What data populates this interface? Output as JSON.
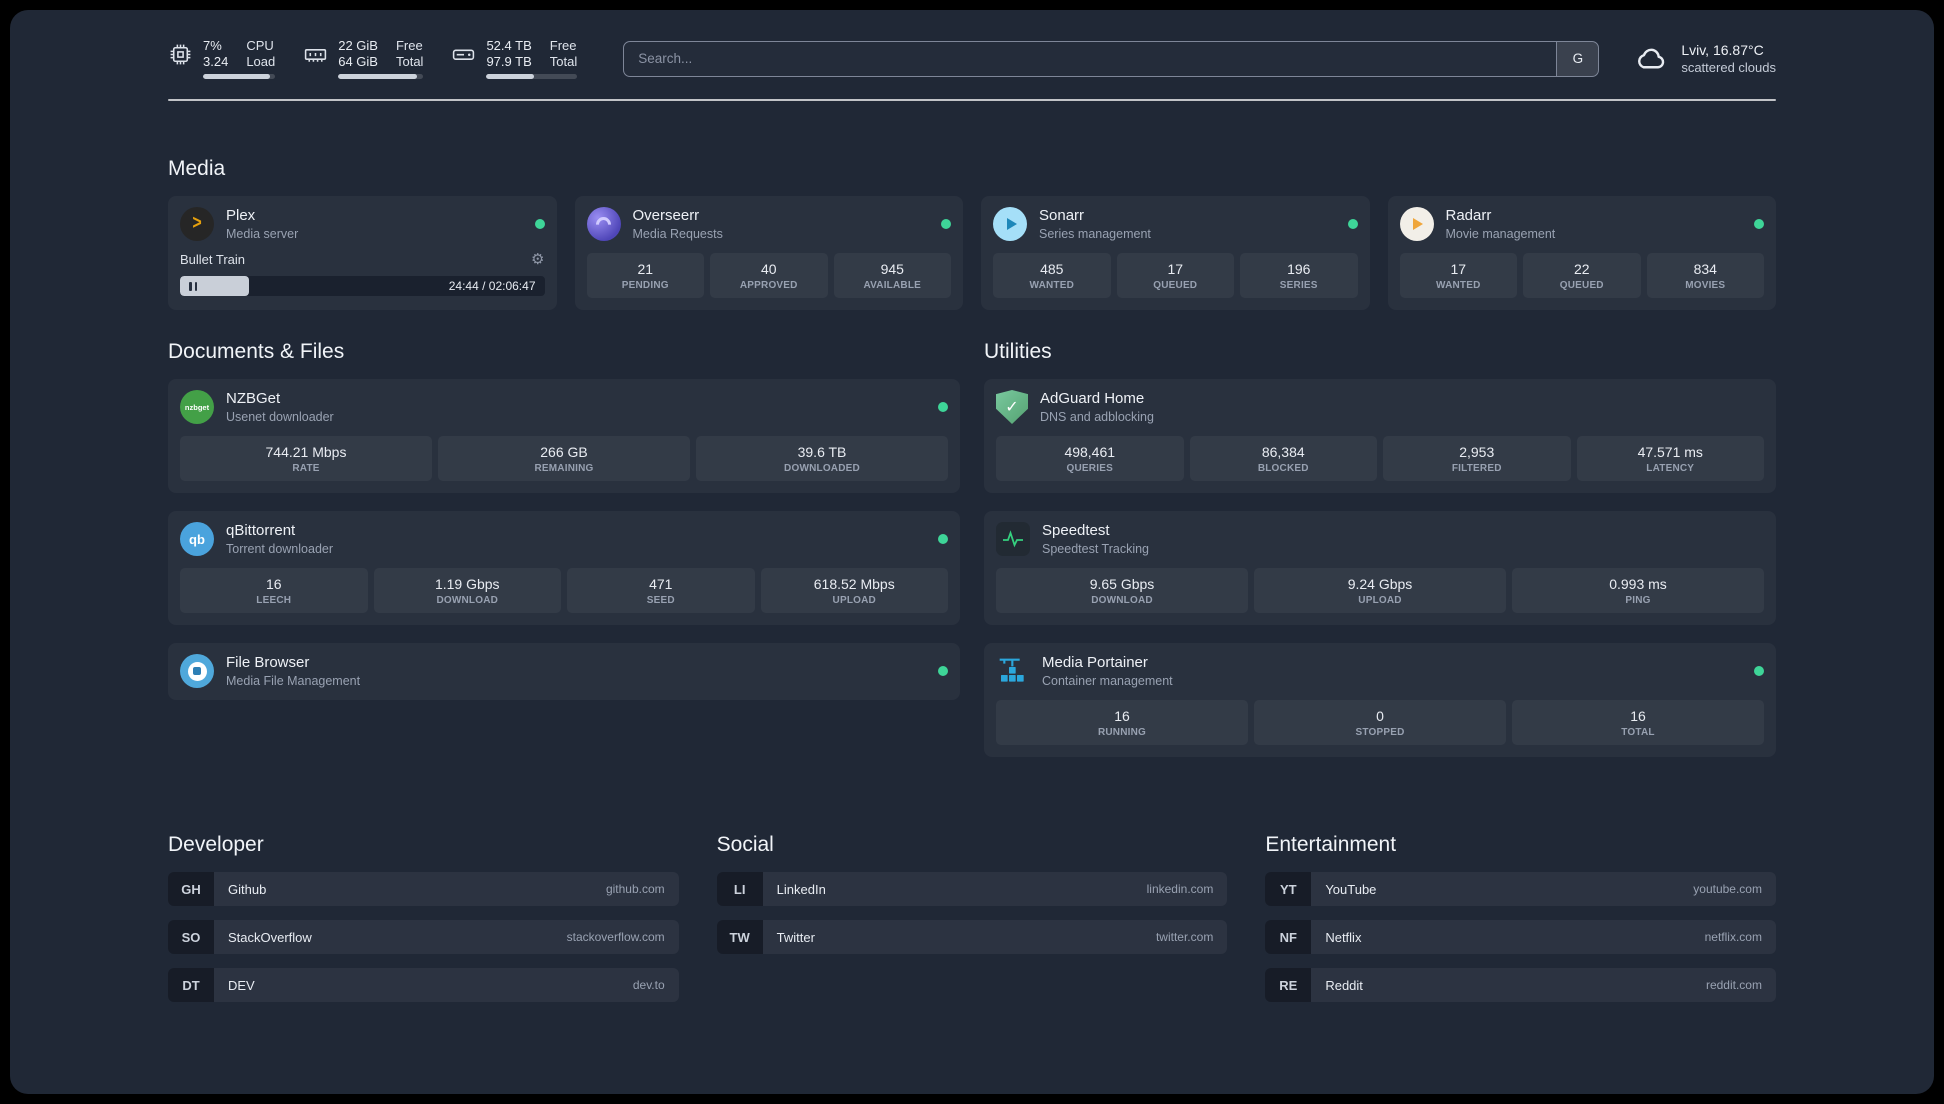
{
  "topbar": {
    "cpu": {
      "value1": "7%",
      "value2": "3.24",
      "label1": "CPU",
      "label2": "Load",
      "bar_style": "width:93%"
    },
    "memory": {
      "value1": "22 GiB",
      "value2": "64 GiB",
      "label1": "Free",
      "label2": "Total",
      "bar_style": "width:93%"
    },
    "disk": {
      "value1": "52.4 TB",
      "value2": "97.9 TB",
      "label1": "Free",
      "label2": "Total",
      "bar_style": "width:52%"
    },
    "search": {
      "placeholder": "Search...",
      "button_label": "G"
    },
    "weather": {
      "location": "Lviv, 16.87°C",
      "condition": "scattered clouds"
    }
  },
  "sections": {
    "media": "Media",
    "documents": "Documents & Files",
    "utilities": "Utilities",
    "developer": "Developer",
    "social": "Social",
    "entertainment": "Entertainment"
  },
  "icons": {
    "gear": "⚙",
    "check": "✓",
    "plex_chevron": ">"
  },
  "plex": {
    "title": "Plex",
    "subtitle": "Media server",
    "now_playing": "Bullet Train",
    "time": "24:44 / 02:06:47",
    "progress_style": "width:19%"
  },
  "overseerr": {
    "title": "Overseerr",
    "subtitle": "Media Requests",
    "stats": [
      {
        "value": "21",
        "label": "PENDING"
      },
      {
        "value": "40",
        "label": "APPROVED"
      },
      {
        "value": "945",
        "label": "AVAILABLE"
      }
    ]
  },
  "sonarr": {
    "title": "Sonarr",
    "subtitle": "Series management",
    "stats": [
      {
        "value": "485",
        "label": "WANTED"
      },
      {
        "value": "17",
        "label": "QUEUED"
      },
      {
        "value": "196",
        "label": "SERIES"
      }
    ]
  },
  "radarr": {
    "title": "Radarr",
    "subtitle": "Movie management",
    "stats": [
      {
        "value": "17",
        "label": "WANTED"
      },
      {
        "value": "22",
        "label": "QUEUED"
      },
      {
        "value": "834",
        "label": "MOVIES"
      }
    ]
  },
  "nzbget": {
    "title": "NZBGet",
    "subtitle": "Usenet downloader",
    "icon_text": "nzbget",
    "stats": [
      {
        "value": "744.21 Mbps",
        "label": "RATE"
      },
      {
        "value": "266 GB",
        "label": "REMAINING"
      },
      {
        "value": "39.6 TB",
        "label": "DOWNLOADED"
      }
    ]
  },
  "qbittorrent": {
    "title": "qBittorrent",
    "subtitle": "Torrent downloader",
    "icon_text": "qb",
    "stats": [
      {
        "value": "16",
        "label": "LEECH"
      },
      {
        "value": "1.19 Gbps",
        "label": "DOWNLOAD"
      },
      {
        "value": "471",
        "label": "SEED"
      },
      {
        "value": "618.52 Mbps",
        "label": "UPLOAD"
      }
    ]
  },
  "filebrowser": {
    "title": "File Browser",
    "subtitle": "Media File Management"
  },
  "adguard": {
    "title": "AdGuard Home",
    "subtitle": "DNS and adblocking",
    "stats": [
      {
        "value": "498,461",
        "label": "QUERIES"
      },
      {
        "value": "86,384",
        "label": "BLOCKED"
      },
      {
        "value": "2,953",
        "label": "FILTERED"
      },
      {
        "value": "47.571 ms",
        "label": "LATENCY"
      }
    ]
  },
  "speedtest": {
    "title": "Speedtest",
    "subtitle": "Speedtest Tracking",
    "stats": [
      {
        "value": "9.65 Gbps",
        "label": "DOWNLOAD"
      },
      {
        "value": "9.24 Gbps",
        "label": "UPLOAD"
      },
      {
        "value": "0.993 ms",
        "label": "PING"
      }
    ]
  },
  "portainer": {
    "title": "Media Portainer",
    "subtitle": "Container management",
    "stats": [
      {
        "value": "16",
        "label": "RUNNING"
      },
      {
        "value": "0",
        "label": "STOPPED"
      },
      {
        "value": "16",
        "label": "TOTAL"
      }
    ]
  },
  "bookmarks": {
    "developer": [
      {
        "abbr": "GH",
        "name": "Github",
        "domain": "github.com"
      },
      {
        "abbr": "SO",
        "name": "StackOverflow",
        "domain": "stackoverflow.com"
      },
      {
        "abbr": "DT",
        "name": "DEV",
        "domain": "dev.to"
      }
    ],
    "social": [
      {
        "abbr": "LI",
        "name": "LinkedIn",
        "domain": "linkedin.com"
      },
      {
        "abbr": "TW",
        "name": "Twitter",
        "domain": "twitter.com"
      }
    ],
    "entertainment": [
      {
        "abbr": "YT",
        "name": "YouTube",
        "domain": "youtube.com"
      },
      {
        "abbr": "NF",
        "name": "Netflix",
        "domain": "netflix.com"
      },
      {
        "abbr": "RE",
        "name": "Reddit",
        "domain": "reddit.com"
      }
    ]
  }
}
